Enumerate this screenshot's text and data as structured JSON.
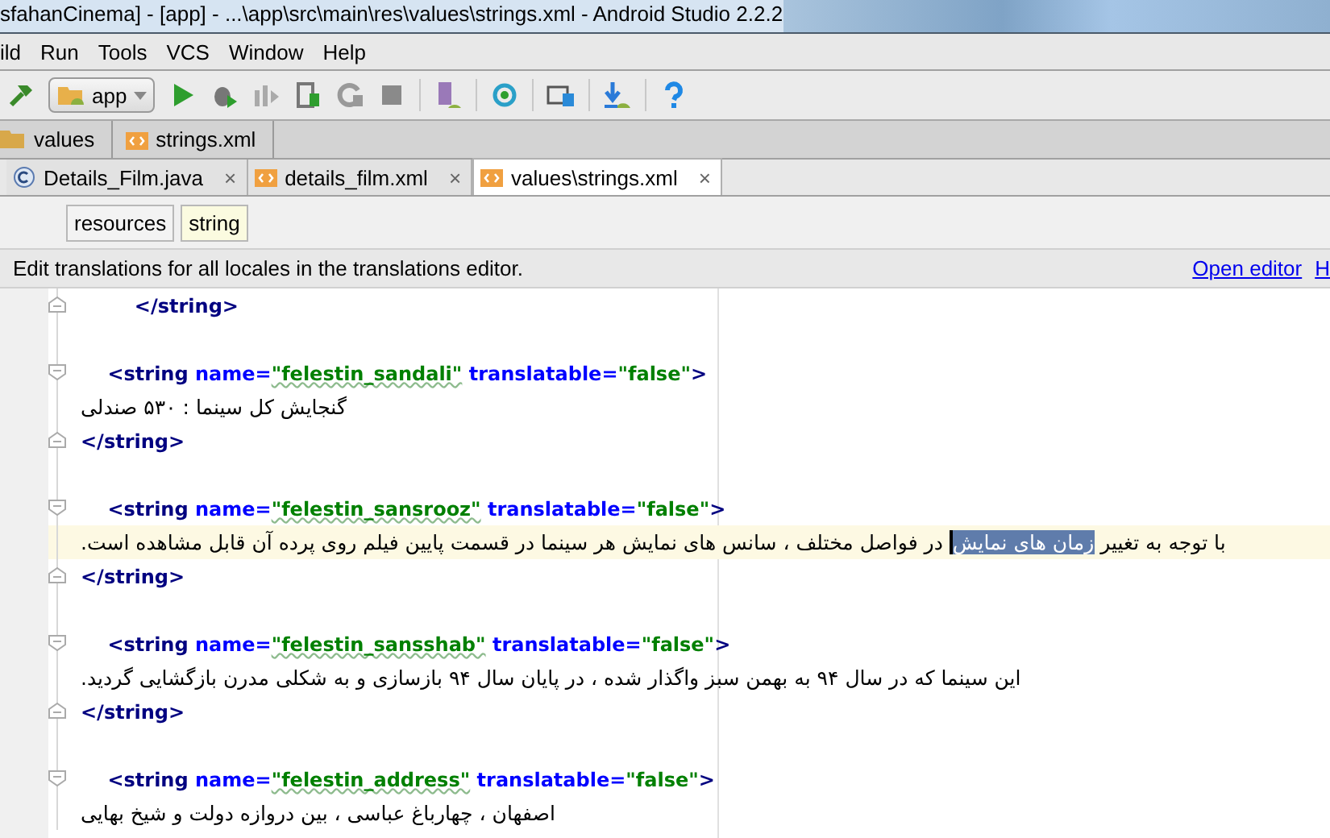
{
  "window": {
    "title": "sfahanCinema] - [app] - ...\\app\\src\\main\\res\\values\\strings.xml - Android Studio 2.2.2"
  },
  "menu": [
    "ild",
    "Run",
    "Tools",
    "VCS",
    "Window",
    "Help"
  ],
  "toolbar": {
    "configuration": "app"
  },
  "breadcrumbs": [
    {
      "label": "values",
      "kind": "folder"
    },
    {
      "label": "strings.xml",
      "kind": "xml"
    }
  ],
  "tabs": [
    {
      "label": "Details_Film.java",
      "kind": "java",
      "selected": false
    },
    {
      "label": "details_film.xml",
      "kind": "xml",
      "selected": false
    },
    {
      "label": "values\\strings.xml",
      "kind": "xml",
      "selected": true
    }
  ],
  "tab_close": "×",
  "xml_path": [
    {
      "label": "resources",
      "selected": false
    },
    {
      "label": "string",
      "selected": true
    }
  ],
  "banner": {
    "text": "Edit translations for all locales in the translations editor.",
    "links": [
      "Open editor",
      "H"
    ]
  },
  "editor": {
    "lines": [
      {
        "kind": "close",
        "text": "        </string>"
      },
      {
        "kind": "blank"
      },
      {
        "kind": "open",
        "tag": "    <string",
        "attributes": [
          {
            "name": " name=",
            "value": "\"felestin_sandali\"",
            "typo": true
          },
          {
            "name": " translatable=",
            "value": "\"false\""
          }
        ],
        "end": ">"
      },
      {
        "kind": "text",
        "segments": [
          {
            "text": "گنجایش کل سینما : ۵۳۰ صندلی",
            "selected": false
          }
        ]
      },
      {
        "kind": "close",
        "text": "</string>"
      },
      {
        "kind": "blank"
      },
      {
        "kind": "open",
        "tag": "    <string",
        "attributes": [
          {
            "name": " name=",
            "value": "\"felestin_sansrooz\"",
            "typo": true
          },
          {
            "name": " translatable=",
            "value": "\"false\""
          }
        ],
        "end": ">"
      },
      {
        "kind": "text",
        "current": true,
        "segments": [
          {
            "text": "با توجه به تغییر ",
            "selected": false
          },
          {
            "text": "زمان های نمایش",
            "selected": true
          },
          {
            "text": " در فواصل مختلف ، سانس های نمایش هر سینما در قسمت پایین فیلم روی پرده آن قابل مشاهده است.",
            "selected": false
          }
        ]
      },
      {
        "kind": "close",
        "text": "</string>"
      },
      {
        "kind": "blank"
      },
      {
        "kind": "open",
        "tag": "    <string",
        "attributes": [
          {
            "name": " name=",
            "value": "\"felestin_sansshab\"",
            "typo": true
          },
          {
            "name": " translatable=",
            "value": "\"false\""
          }
        ],
        "end": ">"
      },
      {
        "kind": "text",
        "segments": [
          {
            "text": "این سینما که در سال ۹۴ به بهمن سبز واگذار شده ، در پایان سال ۹۴ بازسازی و به شکلی مدرن بازگشایی گردید.",
            "selected": false
          }
        ]
      },
      {
        "kind": "close",
        "text": "</string>"
      },
      {
        "kind": "blank"
      },
      {
        "kind": "open",
        "tag": "    <string",
        "attributes": [
          {
            "name": " name=",
            "value": "\"felestin_address\"",
            "typo": true
          },
          {
            "name": " translatable=",
            "value": "\"false\""
          }
        ],
        "end": ">"
      },
      {
        "kind": "text",
        "segments": [
          {
            "text": "اصفهان ، چهارباغ عباسی ، بین دروازه دولت و شیخ بهایی",
            "selected": false
          }
        ]
      }
    ]
  }
}
